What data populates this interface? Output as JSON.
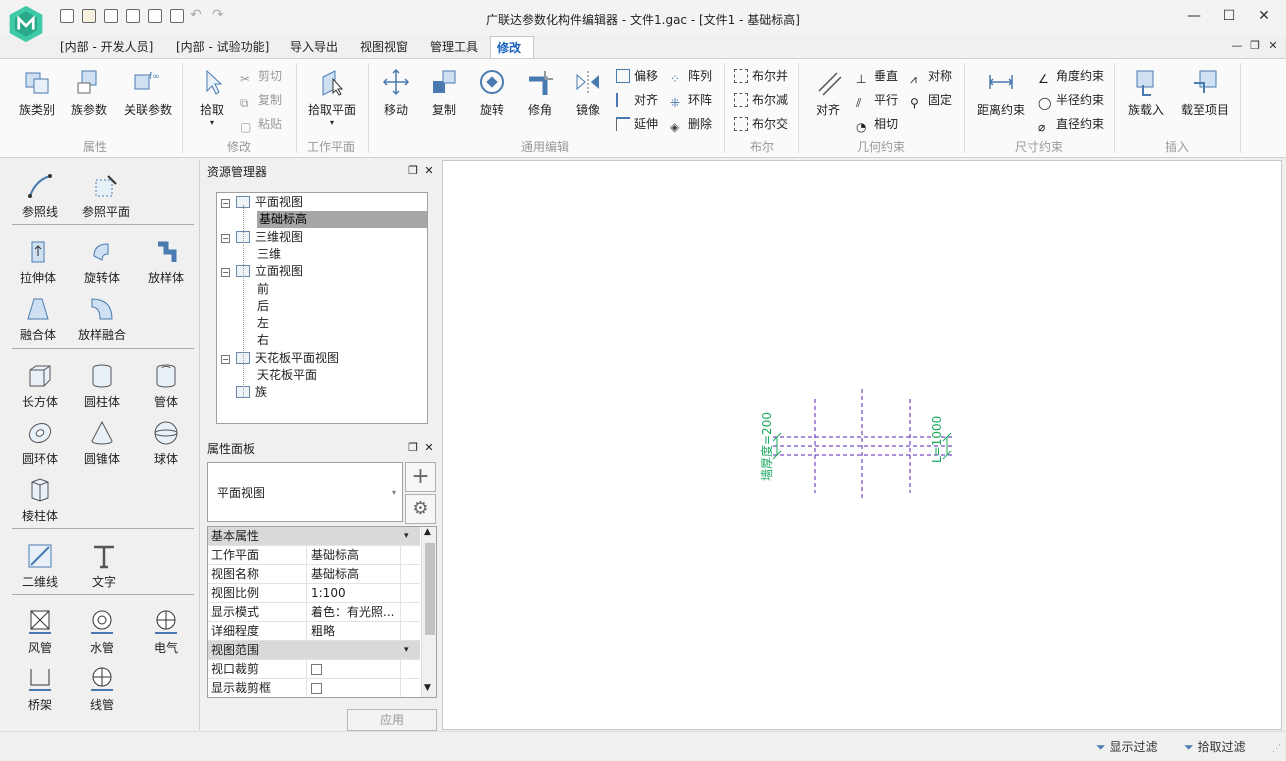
{
  "window": {
    "title": "广联达参数化构件编辑器 - 文件1.gac - [文件1 - 基础标高]",
    "minimize": "—",
    "maximize": "☐",
    "close": "✕"
  },
  "tabs": [
    "[内部 - 开发人员]",
    "[内部 - 试验功能]",
    "导入导出",
    "视图视窗",
    "管理工具",
    "修改"
  ],
  "ribbon": {
    "groups": [
      "属性",
      "修改",
      "工作平面",
      "通用编辑",
      "布尔",
      "几何约束",
      "尺寸约束",
      "插入"
    ],
    "property": [
      "族类别",
      "族参数",
      "关联参数"
    ],
    "modify": {
      "pick": "拾取",
      "cut": "剪切",
      "copy": "复制",
      "paste": "粘贴"
    },
    "workplane": "拾取平面",
    "edit_big": [
      "移动",
      "复制",
      "旋转",
      "修角",
      "镜像"
    ],
    "edit_small": [
      "偏移",
      "对齐",
      "延伸",
      "阵列",
      "环阵",
      "删除"
    ],
    "boolean": [
      "布尔并",
      "布尔减",
      "布尔交"
    ],
    "geo_big": "对齐",
    "geo_small": [
      "垂直",
      "平行",
      "相切",
      "对称",
      "固定"
    ],
    "dim_big": "距离约束",
    "dim_small": [
      "角度约束",
      "半径约束",
      "直径约束"
    ],
    "insert": [
      "族载入",
      "载至项目"
    ]
  },
  "tools": {
    "ref": [
      "参照线",
      "参照平面"
    ],
    "solids1": [
      "拉伸体",
      "旋转体",
      "放样体",
      "融合体",
      "放样融合"
    ],
    "solids2": [
      "长方体",
      "圆柱体",
      "管体",
      "圆环体",
      "圆锥体",
      "球体",
      "棱柱体"
    ],
    "annot": [
      "二维线",
      "文字"
    ],
    "mep": [
      "风管",
      "水管",
      "电气",
      "桥架",
      "线管"
    ]
  },
  "resource": {
    "title": "资源管理器",
    "tree": [
      {
        "label": "平面视图",
        "level": 0,
        "expand": "−"
      },
      {
        "label": "基础标高",
        "level": 1,
        "selected": true
      },
      {
        "label": "三维视图",
        "level": 0,
        "expand": "−"
      },
      {
        "label": "三维",
        "level": 1
      },
      {
        "label": "立面视图",
        "level": 0,
        "expand": "−"
      },
      {
        "label": "前",
        "level": 1
      },
      {
        "label": "后",
        "level": 1
      },
      {
        "label": "左",
        "level": 1
      },
      {
        "label": "右",
        "level": 1
      },
      {
        "label": "天花板平面视图",
        "level": 0,
        "expand": "−"
      },
      {
        "label": "天花板平面",
        "level": 1
      },
      {
        "label": "族",
        "level": 0
      }
    ]
  },
  "props": {
    "title": "属性面板",
    "type": "平面视图",
    "groups": [
      {
        "name": "基本属性",
        "rows": [
          {
            "k": "工作平面",
            "v": "基础标高"
          },
          {
            "k": "视图名称",
            "v": "基础标高"
          },
          {
            "k": "视图比例",
            "v": "1:100"
          },
          {
            "k": "显示模式",
            "v": "着色：有光照..."
          },
          {
            "k": "详细程度",
            "v": "粗略"
          }
        ]
      },
      {
        "name": "视图范围",
        "rows": [
          {
            "k": "视口裁剪",
            "check": true
          },
          {
            "k": "显示裁剪框",
            "check": true
          }
        ]
      }
    ],
    "apply": "应用"
  },
  "canvas": {
    "label_left": "墙厚度=200",
    "label_right": "L=1000"
  },
  "status": {
    "show_filter": "显示过滤",
    "pick_filter": "拾取过滤"
  }
}
